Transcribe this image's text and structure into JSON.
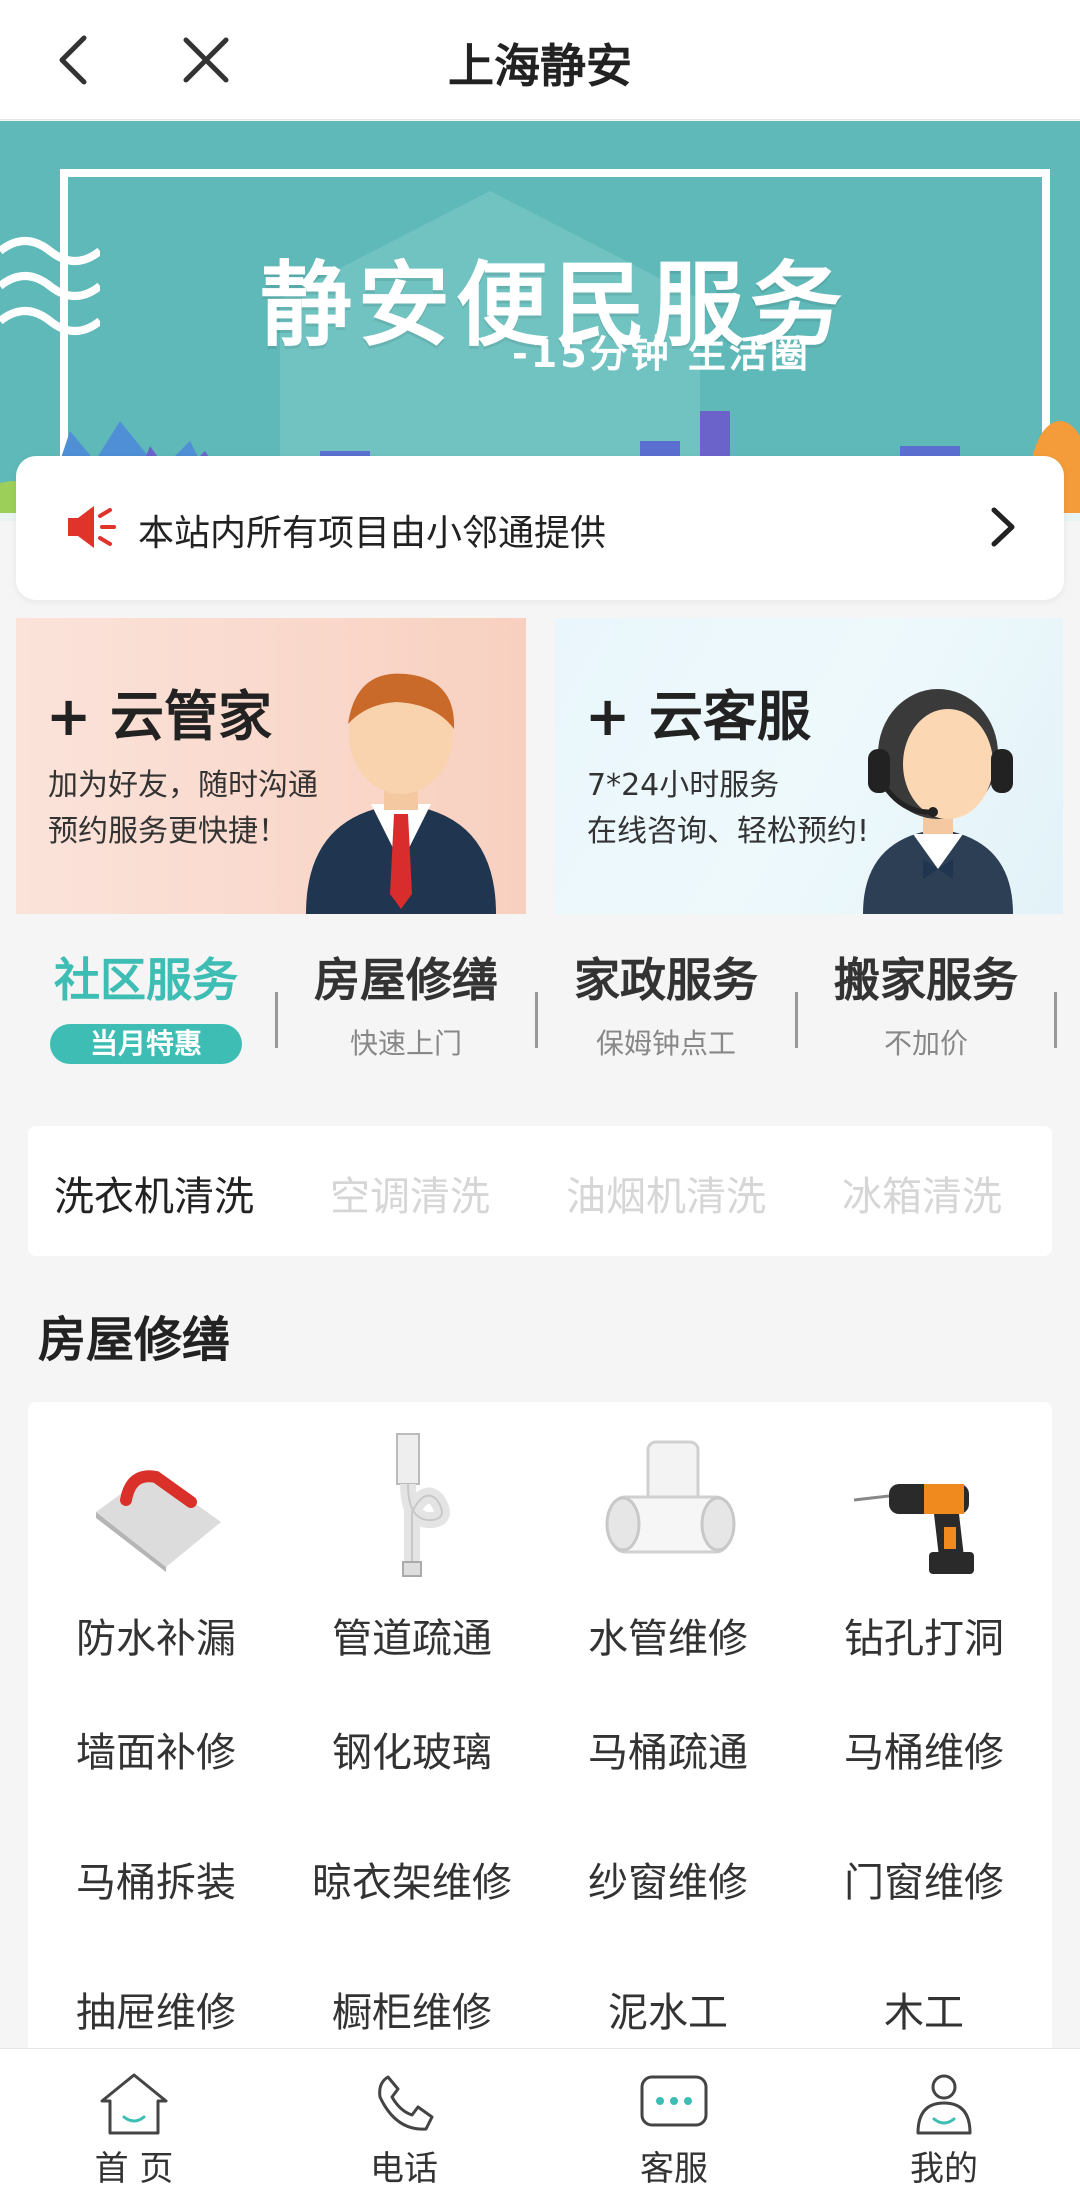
{
  "header": {
    "title": "上海静安",
    "back_icon": "chevron-left-icon",
    "close_icon": "close-icon"
  },
  "banner": {
    "headline": "静安便民服务",
    "sub": "-15分钟 生活圈"
  },
  "notice": {
    "text": "本站内所有项目由小邻通提供",
    "icon": "speaker-icon"
  },
  "cards": [
    {
      "title": "+ 云管家",
      "lines": [
        "加为好友，随时沟通",
        "预约服务更快捷！"
      ]
    },
    {
      "title": "+ 云客服",
      "lines": [
        "7*24小时服务",
        "在线咨询、轻松预约!"
      ]
    }
  ],
  "tabs": [
    {
      "name": "社区服务",
      "sub": "当月特惠"
    },
    {
      "name": "房屋修缮",
      "sub": "快速上门"
    },
    {
      "name": "家政服务",
      "sub": "保姆钟点工"
    },
    {
      "name": "搬家服务",
      "sub": "不加价"
    }
  ],
  "subtabs": [
    "洗衣机清洗",
    "空调清洗",
    "油烟机清洗",
    "冰箱清洗"
  ],
  "section": {
    "title": "房屋修缮"
  },
  "services": {
    "with_icons": [
      {
        "label": "防水补漏",
        "icon": "trowel-icon"
      },
      {
        "label": "管道疏通",
        "icon": "drain-pipe-icon"
      },
      {
        "label": "水管维修",
        "icon": "pipe-fitting-icon"
      },
      {
        "label": "钻孔打洞",
        "icon": "drill-icon"
      }
    ],
    "rows": [
      [
        "墙面补修",
        "钢化玻璃",
        "马桶疏通",
        "马桶维修"
      ],
      [
        "马桶拆装",
        "晾衣架维修",
        "纱窗维修",
        "门窗维修"
      ],
      [
        "抽屉维修",
        "橱柜维修",
        "泥水工",
        "木工"
      ]
    ]
  },
  "bottom_nav": [
    {
      "label": "首 页",
      "icon": "home-icon"
    },
    {
      "label": "电话",
      "icon": "phone-icon"
    },
    {
      "label": "客服",
      "icon": "chat-icon"
    },
    {
      "label": "我的",
      "icon": "user-icon"
    }
  ],
  "colors": {
    "accent": "#3dbdb3",
    "banner": "#5fb9b8",
    "notice_icon": "#e0332c"
  }
}
